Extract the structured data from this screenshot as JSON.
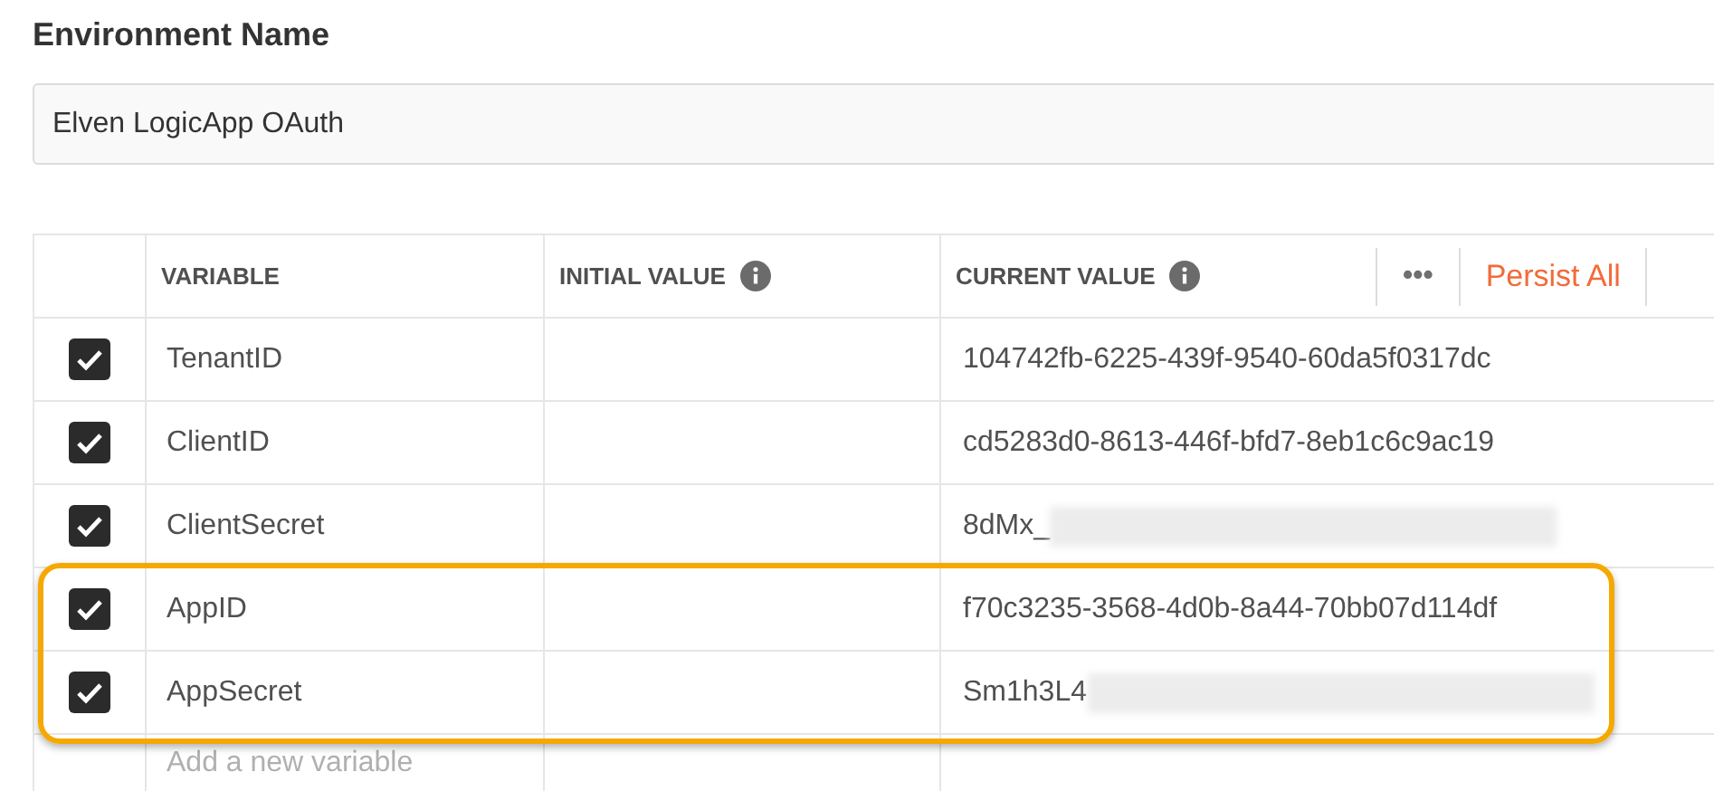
{
  "environment": {
    "label": "Environment Name",
    "value": "Elven LogicApp OAuth"
  },
  "table": {
    "columns": [
      "VARIABLE",
      "INITIAL VALUE",
      "CURRENT VALUE"
    ],
    "actions": {
      "more": "•••",
      "persist": "Persist All"
    },
    "rows": [
      {
        "checked": true,
        "variable": "TenantID",
        "initial": "",
        "current": "104742fb-6225-439f-9540-60da5f0317dc",
        "redacted": false,
        "highlighted": false
      },
      {
        "checked": true,
        "variable": "ClientID",
        "initial": "",
        "current": "cd5283d0-8613-446f-bfd7-8eb1c6c9ac19",
        "redacted": false,
        "highlighted": false
      },
      {
        "checked": true,
        "variable": "ClientSecret",
        "initial": "",
        "current": "8dMx_",
        "redacted": true,
        "highlighted": false
      },
      {
        "checked": true,
        "variable": "AppID",
        "initial": "",
        "current": "f70c3235-3568-4d0b-8a44-70bb07d114df",
        "redacted": false,
        "highlighted": true
      },
      {
        "checked": true,
        "variable": "AppSecret",
        "initial": "",
        "current": "Sm1h3L4",
        "redacted": true,
        "highlighted": true
      }
    ],
    "new_row_placeholder": "Add a new variable"
  }
}
